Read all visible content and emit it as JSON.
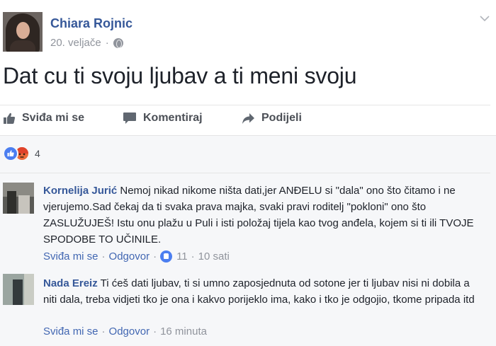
{
  "post": {
    "author": "Chiara Rojnic",
    "date": "20. veljače",
    "date_separator": "·",
    "privacy_icon": "globe-icon",
    "text": "Dat cu ti svoju ljubav a ti meni svoju"
  },
  "actions": {
    "like_label": "Sviđa mi se",
    "comment_label": "Komentiraj",
    "share_label": "Podijeli"
  },
  "reactions": {
    "types": [
      "like",
      "angry"
    ],
    "count": "4"
  },
  "comments": [
    {
      "author": "Kornelija Jurić",
      "text": "Nemoj nikad nikome ništa dati,jer ANĐELU si \"dala\" ono što čitamo i ne vjerujemo.Sad čekaj da ti svaka prava majka, svaki pravi roditelj \"pokloni\" ono što ZASLUŽUJEŠ! Istu onu plažu u Puli i isti položaj tijela kao tvog anđela, kojem si ti ili TVOJE SPODOBE TO UČINILE.",
      "like_label": "Sviđa mi se",
      "reply_label": "Odgovor",
      "like_count": "11",
      "time": "10 sati"
    },
    {
      "author": "Nada Ereiz",
      "text": "Ti ćeš dati ljubav, ti si umno zaposjednuta od sotone jer ti ljubav nisi ni dobila a niti dala, treba vidjeti tko je ona i kakvo porijeklo ima, kako i tko je odgojio, tkome pripada itd",
      "like_label": "Sviđa mi se",
      "reply_label": "Odgovor",
      "time": "16 minuta"
    }
  ],
  "colors": {
    "link_blue": "#365899",
    "action_blue": "#4267b2",
    "meta_grey": "#90949c",
    "background_grey": "#f6f7f9",
    "like_blue": "#4b7ef0",
    "angry_orange": "#ec6b3a"
  }
}
